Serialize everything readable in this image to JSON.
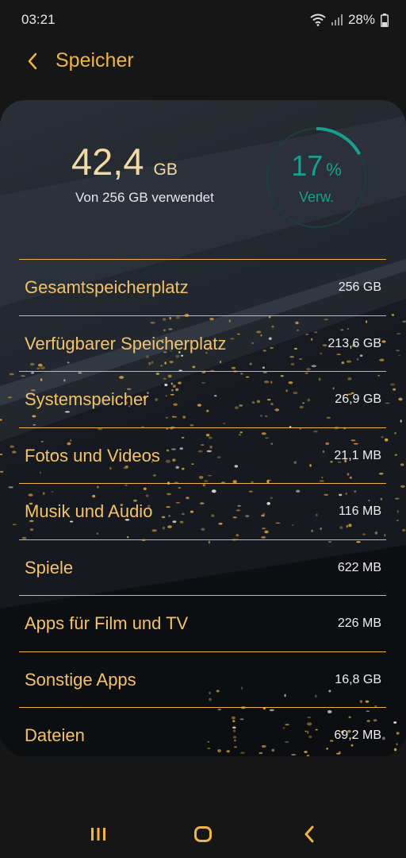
{
  "status": {
    "time": "03:21",
    "battery": "28%"
  },
  "header": {
    "title": "Speicher"
  },
  "summary": {
    "used_value": "42,4",
    "used_unit": "GB",
    "caption": "Von 256 GB verwendet",
    "percent": "17",
    "percent_sign": "%",
    "percent_label": "Verw.",
    "used_fraction": 0.17
  },
  "rows": [
    {
      "label": "Gesamtspeicherplatz",
      "value": "256 GB"
    },
    {
      "label": "Verfügbarer Speicherplatz",
      "value": "213,6 GB"
    },
    {
      "label": "Systemspeicher",
      "value": "26,9 GB"
    },
    {
      "label": "Fotos und Videos",
      "value": "21,1 MB"
    },
    {
      "label": "Musik und Audio",
      "value": "116 MB"
    },
    {
      "label": "Spiele",
      "value": "622 MB"
    },
    {
      "label": "Apps für Film und TV",
      "value": "226 MB"
    },
    {
      "label": "Sonstige Apps",
      "value": "16,8 GB"
    },
    {
      "label": "Dateien",
      "value": "69,2 MB"
    }
  ],
  "colors": {
    "accent": "#f0b442",
    "gauge": "#1a9f8e",
    "background": "#161616"
  },
  "icons": {
    "back": "chevron-left-icon",
    "wifi": "wifi-icon",
    "signal": "signal-icon",
    "battery": "battery-icon",
    "nav_recents": "recents-icon",
    "nav_home": "home-icon",
    "nav_back": "back-icon"
  }
}
